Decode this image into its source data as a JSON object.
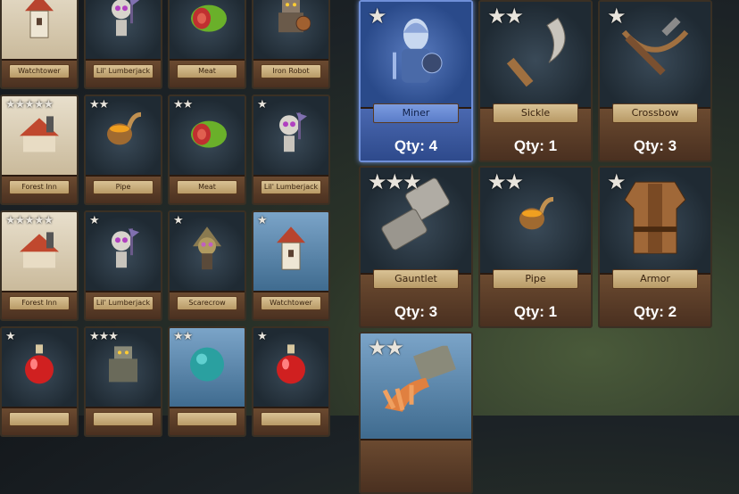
{
  "left_cards": [
    {
      "stars": "★",
      "name": "Watchtower",
      "theme": "tan",
      "icon": "tower-icon"
    },
    {
      "stars": "★",
      "name": "Lil' Lumberjack",
      "theme": "",
      "icon": "skeleton-icon"
    },
    {
      "stars": "★★",
      "name": "Meat",
      "theme": "",
      "icon": "meat-icon"
    },
    {
      "stars": "★★★",
      "name": "Iron Robot",
      "theme": "",
      "icon": "robot-icon"
    },
    {
      "stars": "★★★★★",
      "name": "Forest Inn",
      "theme": "tan",
      "icon": "inn-icon"
    },
    {
      "stars": "★★",
      "name": "Pipe",
      "theme": "",
      "icon": "pipe-icon"
    },
    {
      "stars": "★★",
      "name": "Meat",
      "theme": "",
      "icon": "meat-icon"
    },
    {
      "stars": "★",
      "name": "Lil' Lumberjack",
      "theme": "",
      "icon": "skeleton-icon"
    },
    {
      "stars": "★★★★★",
      "name": "Forest Inn",
      "theme": "tan",
      "icon": "inn-icon"
    },
    {
      "stars": "★",
      "name": "Lil' Lumberjack",
      "theme": "",
      "icon": "skeleton-icon"
    },
    {
      "stars": "★",
      "name": "Scarecrow",
      "theme": "",
      "icon": "scarecrow-icon"
    },
    {
      "stars": "★",
      "name": "Watchtower",
      "theme": "sky",
      "icon": "tower-icon"
    },
    {
      "stars": "★",
      "name": "",
      "theme": "",
      "icon": "potion-icon"
    },
    {
      "stars": "★★★",
      "name": "",
      "theme": "",
      "icon": "golem-icon"
    },
    {
      "stars": "★★",
      "name": "",
      "theme": "sky",
      "icon": "orb-icon"
    },
    {
      "stars": "★",
      "name": "",
      "theme": "",
      "icon": "potion-icon"
    }
  ],
  "right_cards": [
    {
      "stars": "★",
      "name": "Miner",
      "qty": "Qty: 4",
      "theme": "blue",
      "selected": true,
      "icon": "miner-icon"
    },
    {
      "stars": "★★",
      "name": "Sickle",
      "qty": "Qty: 1",
      "theme": "",
      "selected": false,
      "icon": "sickle-icon"
    },
    {
      "stars": "★",
      "name": "Crossbow",
      "qty": "Qty: 3",
      "theme": "",
      "selected": false,
      "icon": "crossbow-icon"
    },
    {
      "stars": "★★★",
      "name": "Gauntlet",
      "qty": "Qty: 3",
      "theme": "",
      "selected": false,
      "icon": "gauntlet-icon"
    },
    {
      "stars": "★★",
      "name": "Pipe",
      "qty": "Qty: 1",
      "theme": "",
      "selected": false,
      "icon": "pipe-icon"
    },
    {
      "stars": "★",
      "name": "Armor",
      "qty": "Qty: 2",
      "theme": "",
      "selected": false,
      "icon": "armor-icon"
    },
    {
      "stars": "★★",
      "name": "",
      "qty": "",
      "theme": "sky",
      "selected": false,
      "icon": "hand-icon"
    }
  ],
  "colors": {
    "accent": "#6f8fd8",
    "wood": "#6b4a30",
    "plate": "#d9c295"
  }
}
